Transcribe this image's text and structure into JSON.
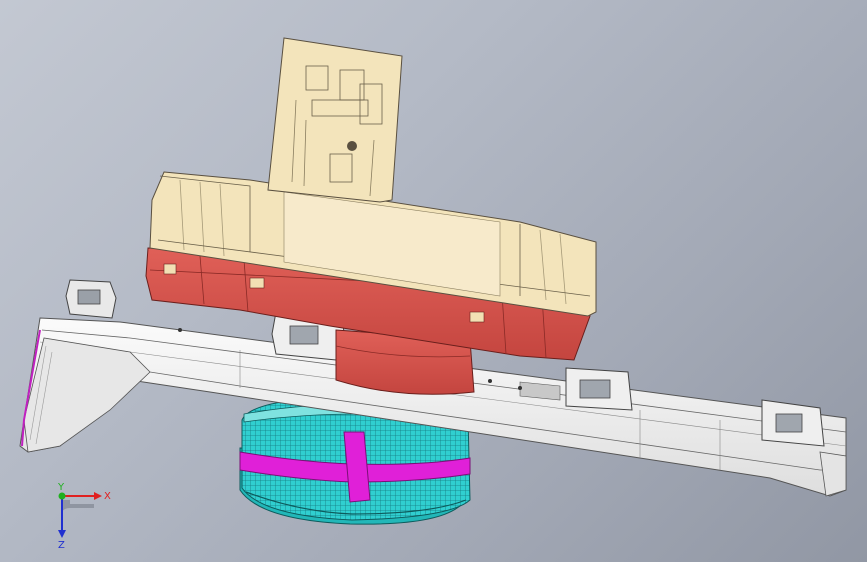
{
  "viewport": {
    "background_color": "#aeb4c0",
    "model_colors": {
      "top_housing": "#f3e3b8",
      "red_housing": "#d9534f",
      "bracket": "#f4f4f4",
      "knob_cyan": "#2fd0d0",
      "knob_magenta": "#e020d8"
    }
  },
  "triad": {
    "x_label": "X",
    "y_label": "Y",
    "z_label": "Z",
    "x_color": "#e02020",
    "y_color": "#20b020",
    "z_color": "#2030d0"
  }
}
